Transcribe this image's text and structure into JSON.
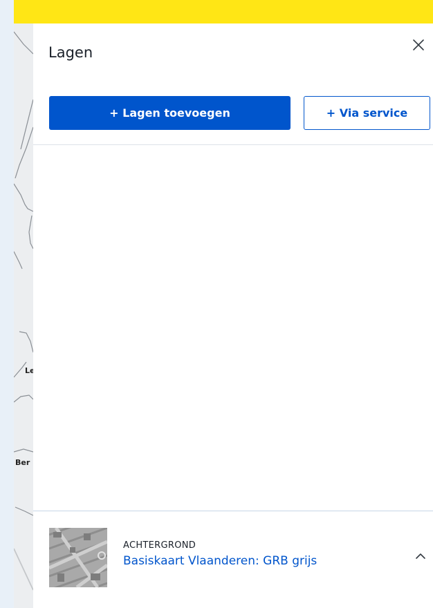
{
  "map": {
    "labels": [
      "Le",
      "Ber"
    ]
  },
  "panel": {
    "title": "Lagen",
    "close_icon": "close-icon"
  },
  "actions": {
    "add_layers_label": "+ Lagen toevoegen",
    "via_service_label": "+ Via service"
  },
  "background_layer": {
    "kicker": "ACHTERGROND",
    "name": "Basiskaart Vlaanderen: GRB grijs",
    "toggle_icon": "chevron-up-icon"
  },
  "colors": {
    "accent": "#0055cc",
    "top_bar": "#ffe615",
    "page_background": "#e8f0f8"
  }
}
